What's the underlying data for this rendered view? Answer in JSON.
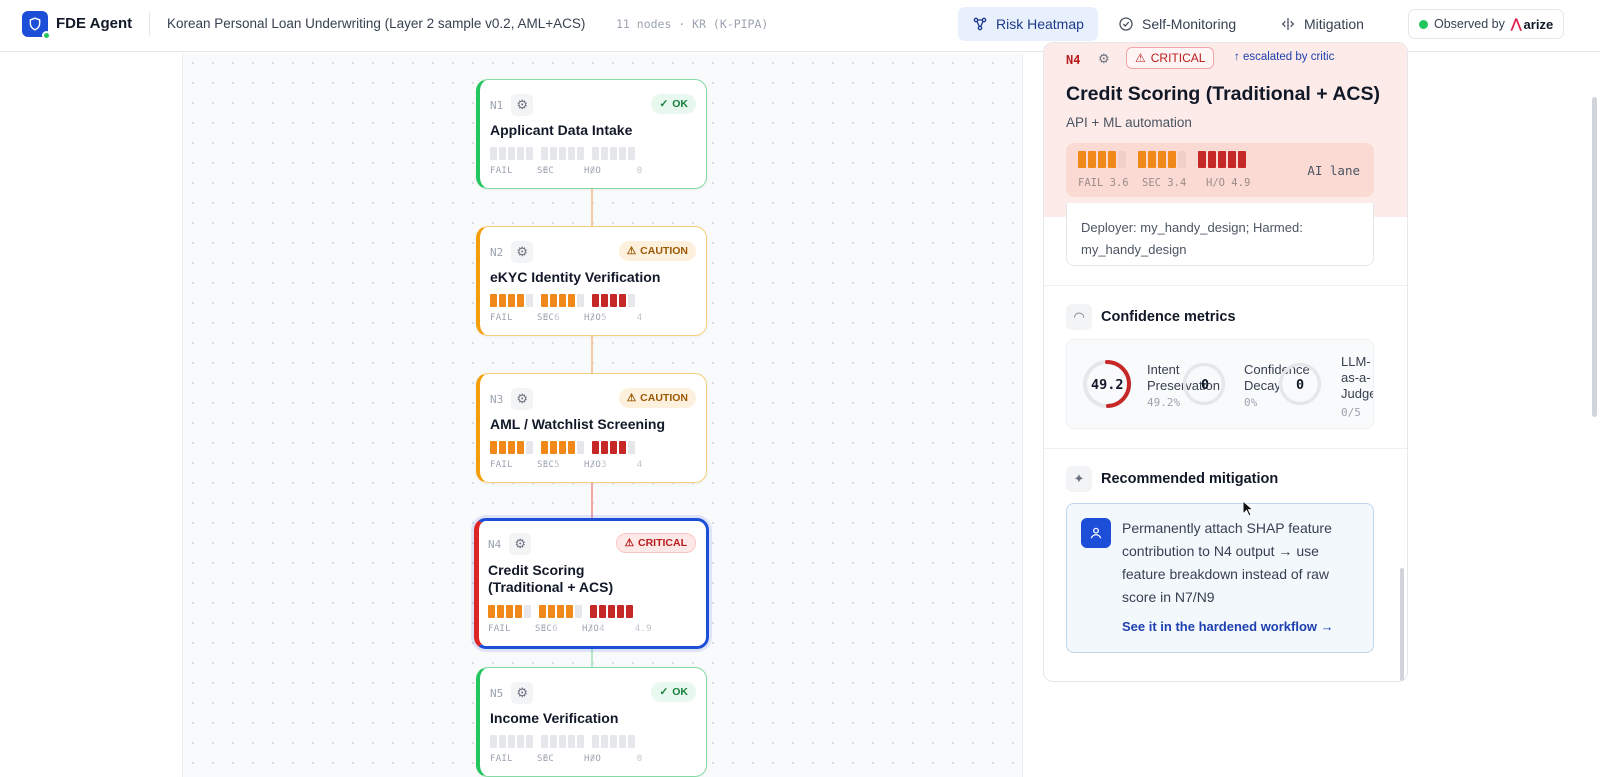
{
  "header": {
    "app_name": "FDE Agent",
    "workflow_title": "Korean Personal Loan Underwriting (Layer 2 sample v0.2, AML+ACS)",
    "workflow_meta": "11 nodes · KR (K-PIPA)",
    "tabs": [
      {
        "label": "Risk Heatmap",
        "icon": "graph-icon",
        "active": true
      },
      {
        "label": "Self-Monitoring",
        "icon": "check-circle-icon",
        "active": false
      },
      {
        "label": "Mitigation",
        "icon": "code-split-icon",
        "active": false
      }
    ],
    "observed_label": "Observed by",
    "observed_brand": "arize"
  },
  "nodes": [
    {
      "id": "N1",
      "title": "Applicant Data Intake",
      "status": "OK",
      "status_class": "ok",
      "fail": "0",
      "sec": "0",
      "ho": "0",
      "fail_filled": 0,
      "sec_filled": 0,
      "ho_filled": 0,
      "ho_color": "r"
    },
    {
      "id": "N2",
      "title": "eKYC Identity Verification",
      "status": "CAUTION",
      "status_class": "caution",
      "fail": "3.6",
      "sec": "3.5",
      "ho": "4",
      "fail_filled": 4,
      "sec_filled": 4,
      "ho_filled": 4,
      "ho_color": "r"
    },
    {
      "id": "N3",
      "title": "AML / Watchlist Screening",
      "status": "CAUTION",
      "status_class": "caution",
      "fail": "3.5",
      "sec": "3.3",
      "ho": "4",
      "fail_filled": 4,
      "sec_filled": 4,
      "ho_filled": 4,
      "ho_color": "r"
    },
    {
      "id": "N4",
      "title": "Credit Scoring (Traditional + ACS)",
      "title_line1": "Credit Scoring",
      "title_line2": "(Traditional + ACS)",
      "status": "CRITICAL",
      "status_class": "critical",
      "fail": "3.6",
      "sec": "3.4",
      "ho": "4.9",
      "fail_filled": 4,
      "sec_filled": 4,
      "ho_filled": 5,
      "ho_color": "r"
    },
    {
      "id": "N5",
      "title": "Income Verification",
      "status": "OK",
      "status_class": "ok",
      "fail": "0",
      "sec": "0",
      "ho": "0",
      "fail_filled": 0,
      "sec_filled": 0,
      "ho_filled": 0,
      "ho_color": "r"
    }
  ],
  "labels": {
    "fail": "FAIL",
    "sec": "SEC",
    "ho": "H/O"
  },
  "panel": {
    "node_id": "N4",
    "badge": "CRITICAL",
    "escalation": "↑ escalated by critic",
    "title": "Credit Scoring (Traditional + ACS)",
    "subtitle": "API + ML automation",
    "fail": "3.6",
    "sec": "3.4",
    "ho": "4.9",
    "lane": "AI lane",
    "deployer_line1": "Deployer: my_handy_design; Harmed:",
    "deployer_line2": "my_handy_design",
    "confidence_title": "Confidence metrics",
    "metrics": [
      {
        "value": "49.2",
        "name_line1": "Intent",
        "name_line2": "Preservation",
        "sub": "49.2%",
        "fraction": 0.492
      },
      {
        "value": "0",
        "name_line1": "Confidence",
        "name_line2": "Decay",
        "sub": "0%",
        "fraction": 0
      },
      {
        "value": "0",
        "name_line1": "LLM-",
        "name_line2": "as-a-",
        "name_line3": "Judge",
        "sub": "0/5",
        "fraction": 0
      }
    ],
    "mitigation_title": "Recommended mitigation",
    "mitigation_text": "Permanently attach SHAP feature contribution to N4 output → use feature breakdown instead of raw score in N7/N9",
    "mitigation_link": "See it in the hardened workflow →"
  },
  "colors": {
    "accent": "#1d4ed8",
    "ok": "#22c55e",
    "caution": "#f59e0b",
    "critical": "#dc2626",
    "bar_orange": "#f0891a",
    "bar_red": "#c62828"
  }
}
